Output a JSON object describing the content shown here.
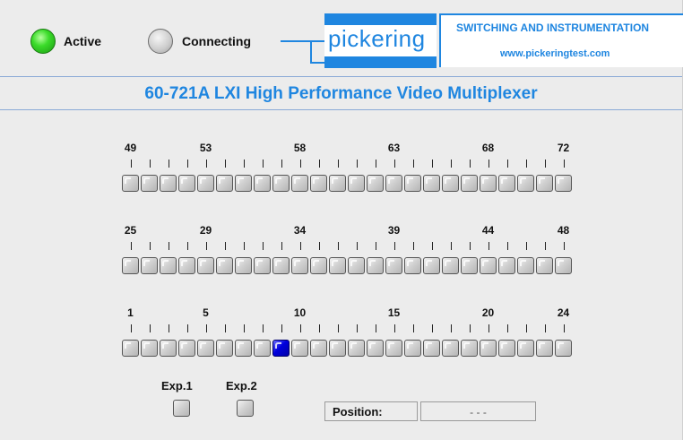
{
  "status": {
    "active_label": "Active",
    "connecting_label": "Connecting"
  },
  "logo": {
    "brand": "pickering",
    "tagline": "SWITCHING AND INSTRUMENTATION",
    "url": "www.pickeringtest.com",
    "brand_color": "#1f86e0"
  },
  "title": "60-721A LXI High Performance Video Multiplexer",
  "banks": [
    {
      "labels": [
        "49",
        "53",
        "58",
        "63",
        "68",
        "72"
      ],
      "label_channels": [
        49,
        53,
        58,
        63,
        68,
        72
      ],
      "start": 49,
      "end": 72
    },
    {
      "labels": [
        "25",
        "29",
        "34",
        "39",
        "44",
        "48"
      ],
      "label_channels": [
        25,
        29,
        34,
        39,
        44,
        48
      ],
      "start": 25,
      "end": 48
    },
    {
      "labels": [
        "1",
        "5",
        "10",
        "15",
        "20",
        "24"
      ],
      "label_channels": [
        1,
        5,
        10,
        15,
        20,
        24
      ],
      "start": 1,
      "end": 24
    }
  ],
  "selected_channel": 9,
  "expansion": {
    "exp1_label": "Exp.1",
    "exp2_label": "Exp.2"
  },
  "position": {
    "label": "Position:",
    "value": "- - -"
  },
  "colors": {
    "active_led": "#3bdc2a",
    "relay_on": "#0000dd",
    "relay_off": "#cfcfcf"
  }
}
